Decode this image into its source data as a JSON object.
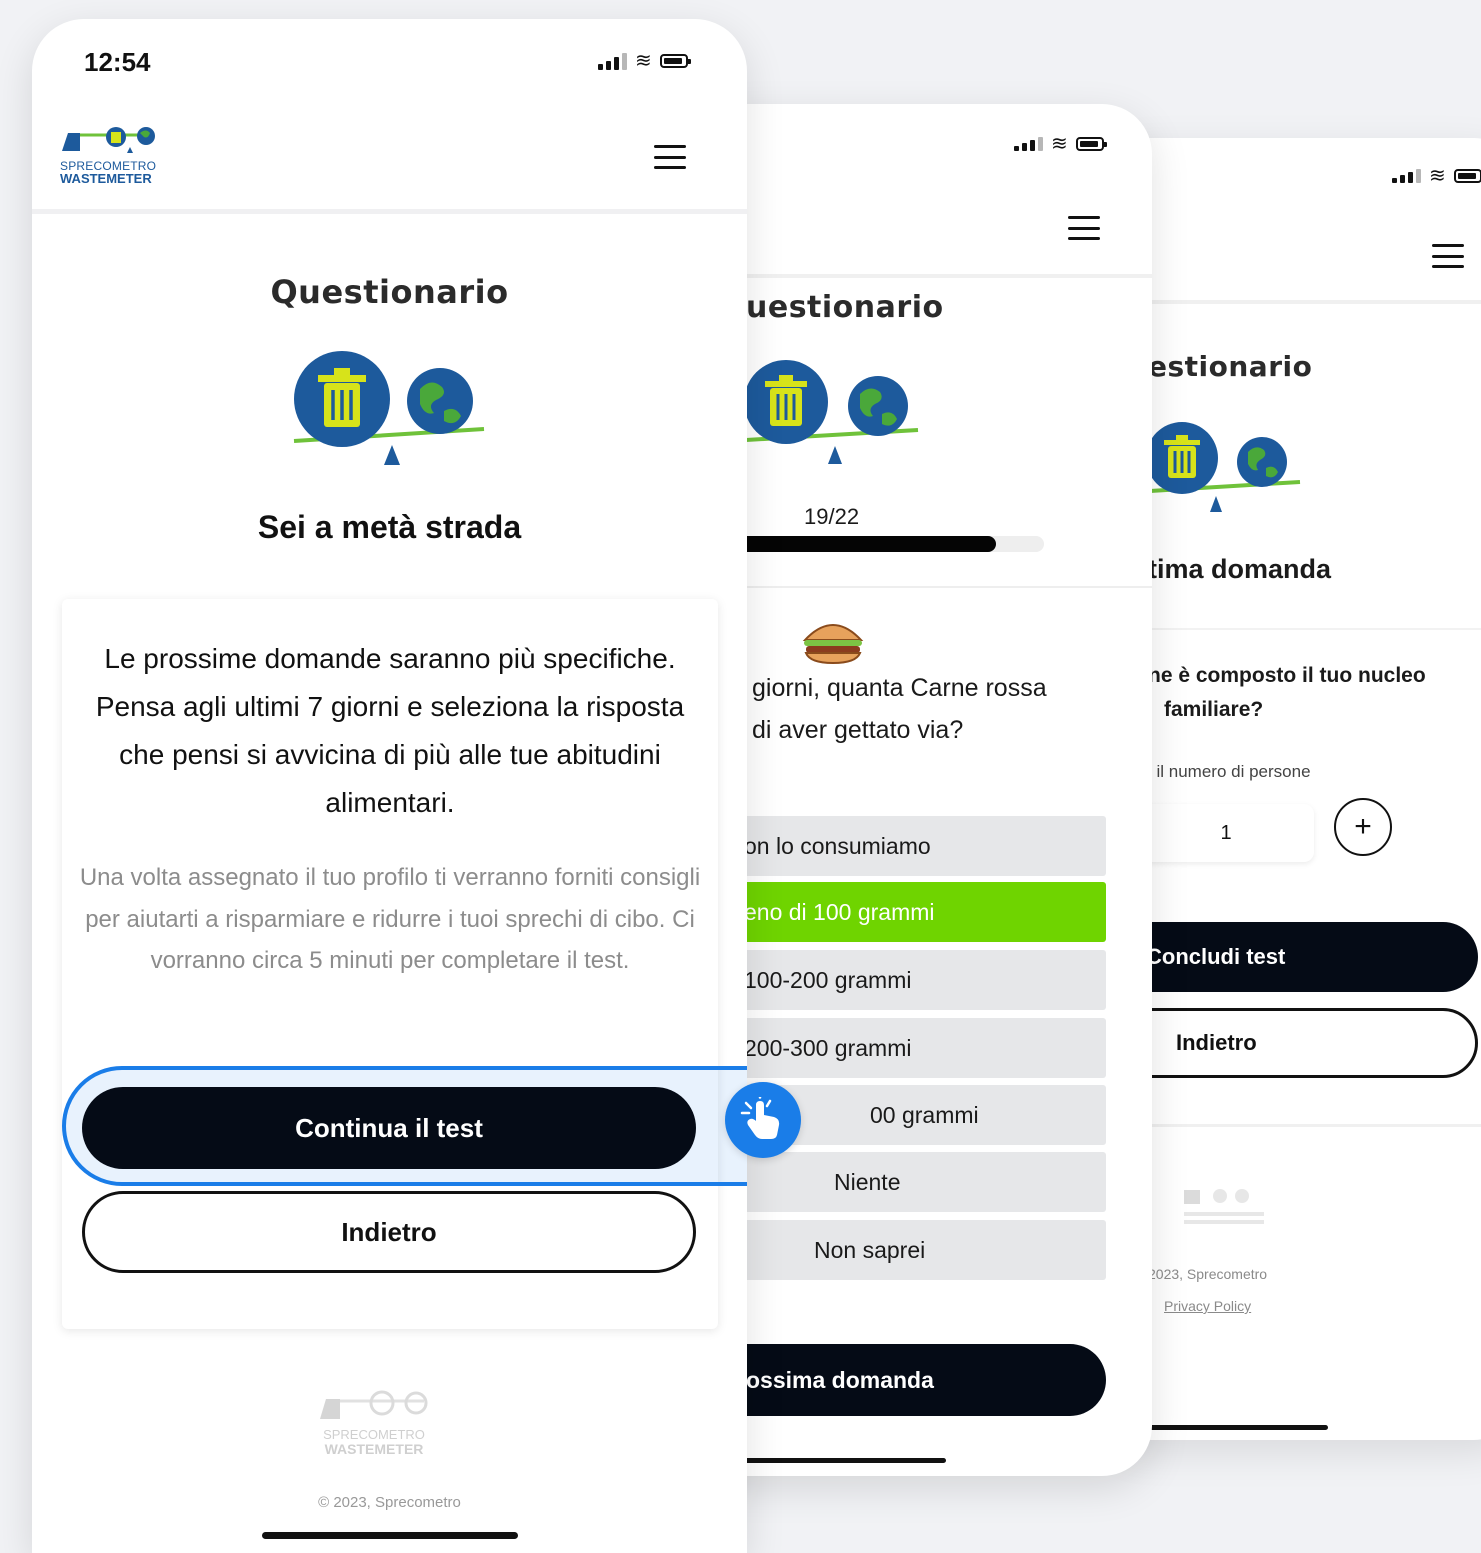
{
  "screen3": {
    "title": "estionario",
    "subtitle": "tima domanda",
    "question_line1": "ne è composto il tuo nucleo",
    "question_line2": "familiare?",
    "input_label": "i il numero di persone",
    "stepper_value": "1",
    "plus_symbol": "+",
    "primary_button": "Concludi test",
    "secondary_button": "Indietro",
    "footer_copyright": "2023, Sprecometro",
    "footer_link": "Privacy Policy"
  },
  "screen2": {
    "title": "uestionario",
    "progress_text": "19/22",
    "progress_value": 0.8636,
    "question_line1": "giorni, quanta Carne rossa",
    "question_line2": "di aver gettato via?",
    "options": [
      "on lo consumiamo",
      "eno di 100 grammi",
      "100-200 grammi",
      "200-300 grammi",
      "00 grammi",
      "Niente",
      "Non saprei"
    ],
    "selected_option_index": 1,
    "next_button": "ossima domanda"
  },
  "screen1": {
    "status_time": "12:54",
    "logo_line1": "SPRECOMETRO",
    "logo_line2": "WASTEMETER",
    "title": "Questionario",
    "subtitle": "Sei a metà strada",
    "card_text": "Le prossime domande saranno più specifiche. Pensa agli ultimi 7 giorni e seleziona la risposta che pensi si avvicina di più alle tue abitudini alimentari.",
    "card_subtext": "Una volta assegnato il tuo profilo ti verranno forniti consigli per aiutarti a risparmiare e ridurre i tuoi sprechi di cibo. Ci vorranno circa 5 minuti per completare il test.",
    "primary_button": "Continua il test",
    "secondary_button": "Indietro",
    "footer_logo_line1": "SPRECOMETRO",
    "footer_logo_line2": "WASTEMETER",
    "footer_copyright": "© 2023, Sprecometro"
  },
  "colors": {
    "accent_green": "#6fd400",
    "logo_blue": "#1d5a9c",
    "highlight_blue": "#1a7de8",
    "dark_button": "#050b16"
  },
  "icons": [
    "signal-icon",
    "wifi-icon",
    "battery-icon",
    "menu-icon",
    "trash-scale-illustration",
    "globe-icon",
    "burger-icon",
    "plus-icon",
    "tap-hand-icon"
  ]
}
